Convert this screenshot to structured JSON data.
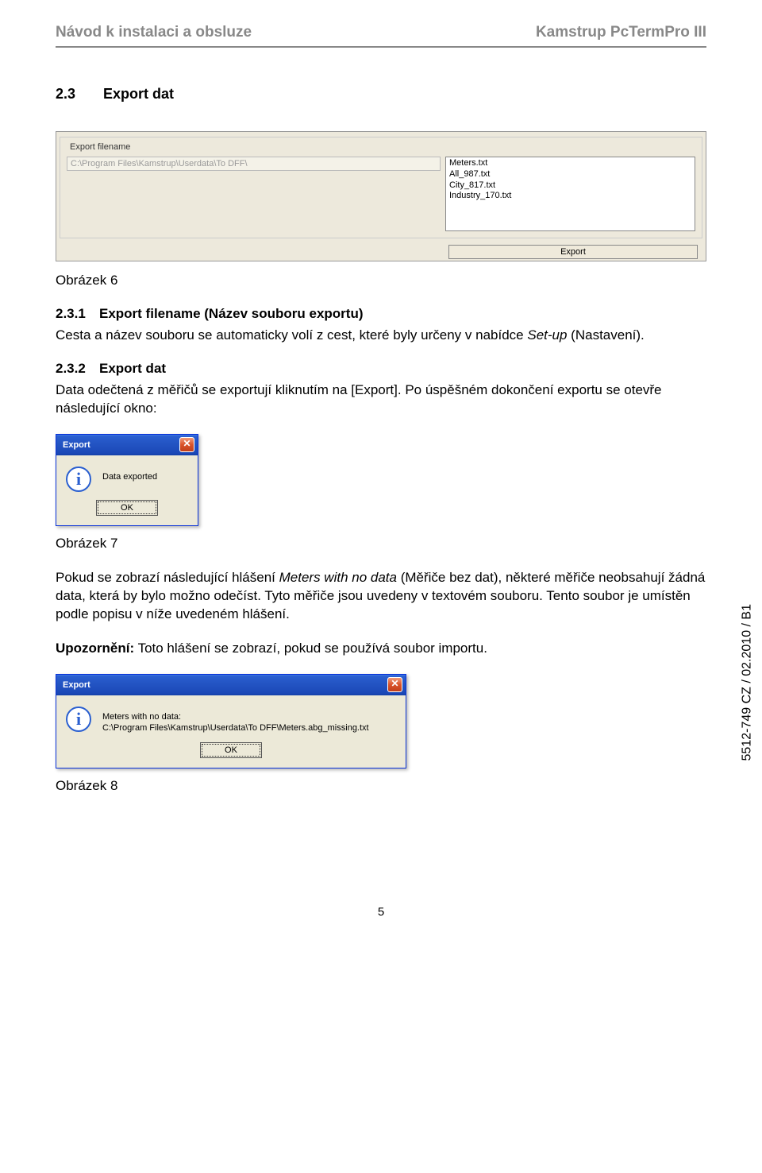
{
  "header": {
    "left": "Návod k instalaci a obsluze",
    "right": "Kamstrup PcTermPro III"
  },
  "section": {
    "num": "2.3",
    "title": "Export dat"
  },
  "shot1": {
    "group_label": "Export filename",
    "path": "C:\\Program Files\\Kamstrup\\Userdata\\To DFF\\",
    "files": [
      "Meters.txt",
      "All_987.txt",
      "City_817.txt",
      "Industry_170.txt"
    ],
    "export_btn": "Export"
  },
  "captions": {
    "fig6": "Obrázek 6",
    "fig7": "Obrázek 7",
    "fig8": "Obrázek 8"
  },
  "sub231": {
    "num": "2.3.1",
    "title": "Export filename (Název souboru exportu)",
    "para_a": "Cesta a název souboru se automaticky volí z cest, které byly určeny v nabídce ",
    "para_b_italic": "Set-up",
    "para_c": " (Nastavení)."
  },
  "sub232": {
    "num": "2.3.2",
    "title": "Export dat",
    "para": "Data odečtená z měřičů se exportují kliknutím na [Export]. Po úspěšném dokončení exportu se otevře následující okno:"
  },
  "dlg1": {
    "title": "Export",
    "msg": "Data exported",
    "ok": "OK"
  },
  "para_meters_a": "Pokud se zobrazí následující hlášení ",
  "para_meters_italic": "Meters with no data",
  "para_meters_b": " (Měřiče bez dat), některé měřiče neobsahují žádná data, která by bylo možno odečíst. Tyto měřiče jsou uvedeny v textovém souboru. Tento soubor je umístěn podle popisu v níže uvedeném hlášení.",
  "warn_label": "Upozornění:",
  "warn_text": " Toto hlášení se zobrazí, pokud se používá soubor importu.",
  "dlg2": {
    "title": "Export",
    "line1": "Meters with no data:",
    "line2": "C:\\Program Files\\Kamstrup\\Userdata\\To DFF\\Meters.abg_missing.txt",
    "ok": "OK"
  },
  "sidecode": "5512-749 CZ / 02.2010 / B1",
  "pagenum": "5"
}
